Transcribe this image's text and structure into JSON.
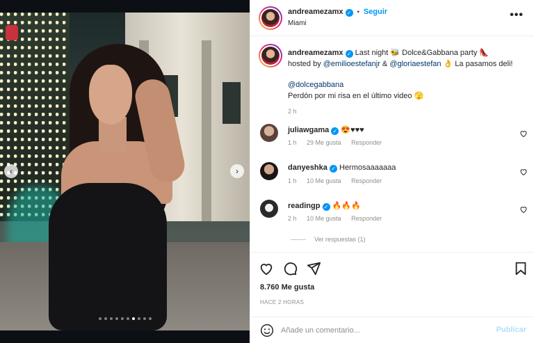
{
  "post": {
    "username": "andreamezamx",
    "follow_label": "Seguir",
    "location": "Miami",
    "verified_mark": "✓",
    "separator": "•",
    "more_glyph": "•••"
  },
  "caption": {
    "username": "andreamezamx",
    "text_1": "Last night 🐝 Dolce&Gabbana party 👠",
    "hosted_prefix": "hosted by",
    "mention_1": "@emilioestefanjr",
    "amp": "&",
    "mention_2": "@gloriaestefan",
    "text_2": "👌 La pasamos deli!",
    "mention_3": "@dolcegabbana",
    "text_3": "Perdón por mi risa en el último video 🫣",
    "time": "2 h"
  },
  "comments": [
    {
      "username": "juliawgama",
      "text": "😍♥♥♥",
      "time": "1 h",
      "likes": "29 Me gusta",
      "reply": "Responder"
    },
    {
      "username": "danyeshka",
      "text": "Hermosaaaaaaa",
      "time": "1 h",
      "likes": "10 Me gusta",
      "reply": "Responder"
    },
    {
      "username": "readingp",
      "text": "🔥🔥🔥",
      "time": "2 h",
      "likes": "10 Me gusta",
      "reply": "Responder"
    }
  ],
  "view_replies": "Ver respuestas (1)",
  "stats": {
    "likes": "8.760 Me gusta",
    "ago": "HACE 2 HORAS"
  },
  "composer": {
    "placeholder": "Añade un comentario...",
    "publish": "Publicar"
  },
  "carousel": {
    "prev": "‹",
    "next": "›",
    "total_slides": 10,
    "active_slide": 7
  },
  "icons": {
    "heart": "heart-icon",
    "comment": "comment-icon",
    "share": "share-icon",
    "save": "bookmark-icon",
    "emoji": "emoji-icon"
  },
  "colors": {
    "accent": "#0095f6",
    "publish_disabled": "#b2dffc",
    "muted": "#8e8e8e"
  }
}
